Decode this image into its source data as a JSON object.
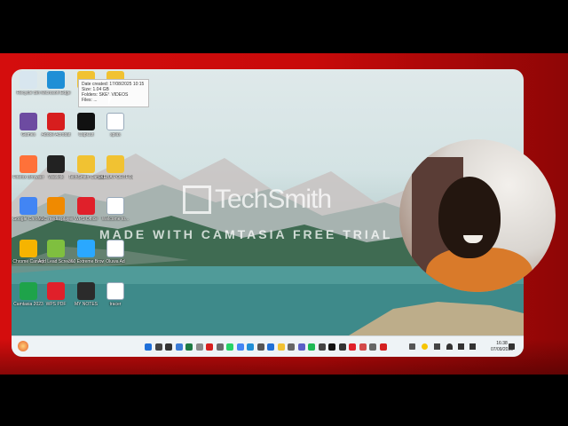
{
  "tooltip": {
    "line1": "Date created: 17/08/2025 10:15",
    "line2": "Size: 1.04 GB",
    "line3": "Folders: SKEL VIDEOS",
    "line4": "Files: ..."
  },
  "watermark": {
    "brand": "TechSmith",
    "subtitle": "MADE WITH CAMTASIA FREE TRIAL"
  },
  "desktop_icons": [
    {
      "label": "Recycle Bin",
      "icon": "recycle-bin-icon",
      "color": "#d8e6ef"
    },
    {
      "label": "Microsoft Edge",
      "icon": "edge-icon",
      "color": "#1f8fd6"
    },
    {
      "label": "",
      "icon": "folder-icon",
      "color": "#f1c232"
    },
    {
      "label": "",
      "icon": "folder-icon",
      "color": "#f1c232"
    },
    {
      "label": "Games",
      "icon": "games-icon",
      "color": "#6d4ba1"
    },
    {
      "label": "Adobe Acrobat",
      "icon": "acrobat-icon",
      "color": "#d71e1e"
    },
    {
      "label": "CapCut",
      "icon": "capcut-icon",
      "color": "#111111"
    },
    {
      "label": "splas",
      "icon": "file-icon",
      "color": "#ffffff"
    },
    {
      "label": "Firefox Browser",
      "icon": "firefox-icon",
      "color": "#ff7139"
    },
    {
      "label": "Wavlink",
      "icon": "wavlink-icon",
      "color": "#222222"
    },
    {
      "label": "TechSmith Camtasia 2...",
      "icon": "folder-icon",
      "color": "#f1c232"
    },
    {
      "label": "SKEBA PORTFOL 3",
      "icon": "folder-icon",
      "color": "#f1c232"
    },
    {
      "label": "Google Chrome",
      "icon": "chrome-icon",
      "color": "#4285f4"
    },
    {
      "label": "VLC media player",
      "icon": "vlc-icon",
      "color": "#f08a00"
    },
    {
      "label": "WPS Office",
      "icon": "wps-office-icon",
      "color": "#e0202a"
    },
    {
      "label": "Welcome to...",
      "icon": "file-icon",
      "color": "#ffffff"
    },
    {
      "label": "Chrome Canary",
      "icon": "chrome-canary-icon",
      "color": "#f6b400"
    },
    {
      "label": "Add Lead Screens",
      "icon": "app-icon",
      "color": "#7fbf3f"
    },
    {
      "label": "360 Extreme Browser",
      "icon": "extreme-browser-icon",
      "color": "#2aa8ff"
    },
    {
      "label": "Oluwa Ad",
      "icon": "file-icon",
      "color": "#ffffff"
    },
    {
      "label": "Camtasia 2023",
      "icon": "camtasia-icon",
      "color": "#1ea34a"
    },
    {
      "label": "WPS PDF",
      "icon": "wps-pdf-icon",
      "color": "#e0202a"
    },
    {
      "label": "MY NOTES",
      "icon": "folder-icon",
      "color": "#2b2b2b"
    },
    {
      "label": "tracer",
      "icon": "file-icon",
      "color": "#ffffff"
    }
  ],
  "taskbar_icons": [
    {
      "icon": "start-icon",
      "color": "#1e6fd9"
    },
    {
      "icon": "search-icon",
      "color": "#444444"
    },
    {
      "icon": "task-view-icon",
      "color": "#333333"
    },
    {
      "icon": "widgets-icon",
      "color": "#3a7bd5"
    },
    {
      "icon": "excel-icon",
      "color": "#1d7a43"
    },
    {
      "icon": "app-icon",
      "color": "#8a8a8a"
    },
    {
      "icon": "acrobat-icon",
      "color": "#d71e1e"
    },
    {
      "icon": "app-icon",
      "color": "#6a6a6a"
    },
    {
      "icon": "whatsapp-icon",
      "color": "#25d366"
    },
    {
      "icon": "chrome-icon",
      "color": "#4285f4"
    },
    {
      "icon": "edge-icon",
      "color": "#1f8fd6"
    },
    {
      "icon": "store-icon",
      "color": "#555555"
    },
    {
      "icon": "mail-icon",
      "color": "#1f6fd6"
    },
    {
      "icon": "folder-icon",
      "color": "#f1c232"
    },
    {
      "icon": "settings-icon",
      "color": "#666666"
    },
    {
      "icon": "teams-icon",
      "color": "#5b5fc7"
    },
    {
      "icon": "spotify-icon",
      "color": "#1db954"
    },
    {
      "icon": "app-icon",
      "color": "#444444"
    },
    {
      "icon": "capcut-icon",
      "color": "#111111"
    },
    {
      "icon": "app-icon",
      "color": "#333333"
    },
    {
      "icon": "wps-office-icon",
      "color": "#e0202a"
    },
    {
      "icon": "app-icon",
      "color": "#d34a4a"
    },
    {
      "icon": "app-icon",
      "color": "#666666"
    },
    {
      "icon": "camtasia-icon",
      "color": "#d42020"
    }
  ],
  "tray": {
    "time": "16:38",
    "date": "07/09/2025"
  },
  "colors": {
    "frame_red": "#d40d0d",
    "taskbar_bg": "#eef3f6"
  }
}
